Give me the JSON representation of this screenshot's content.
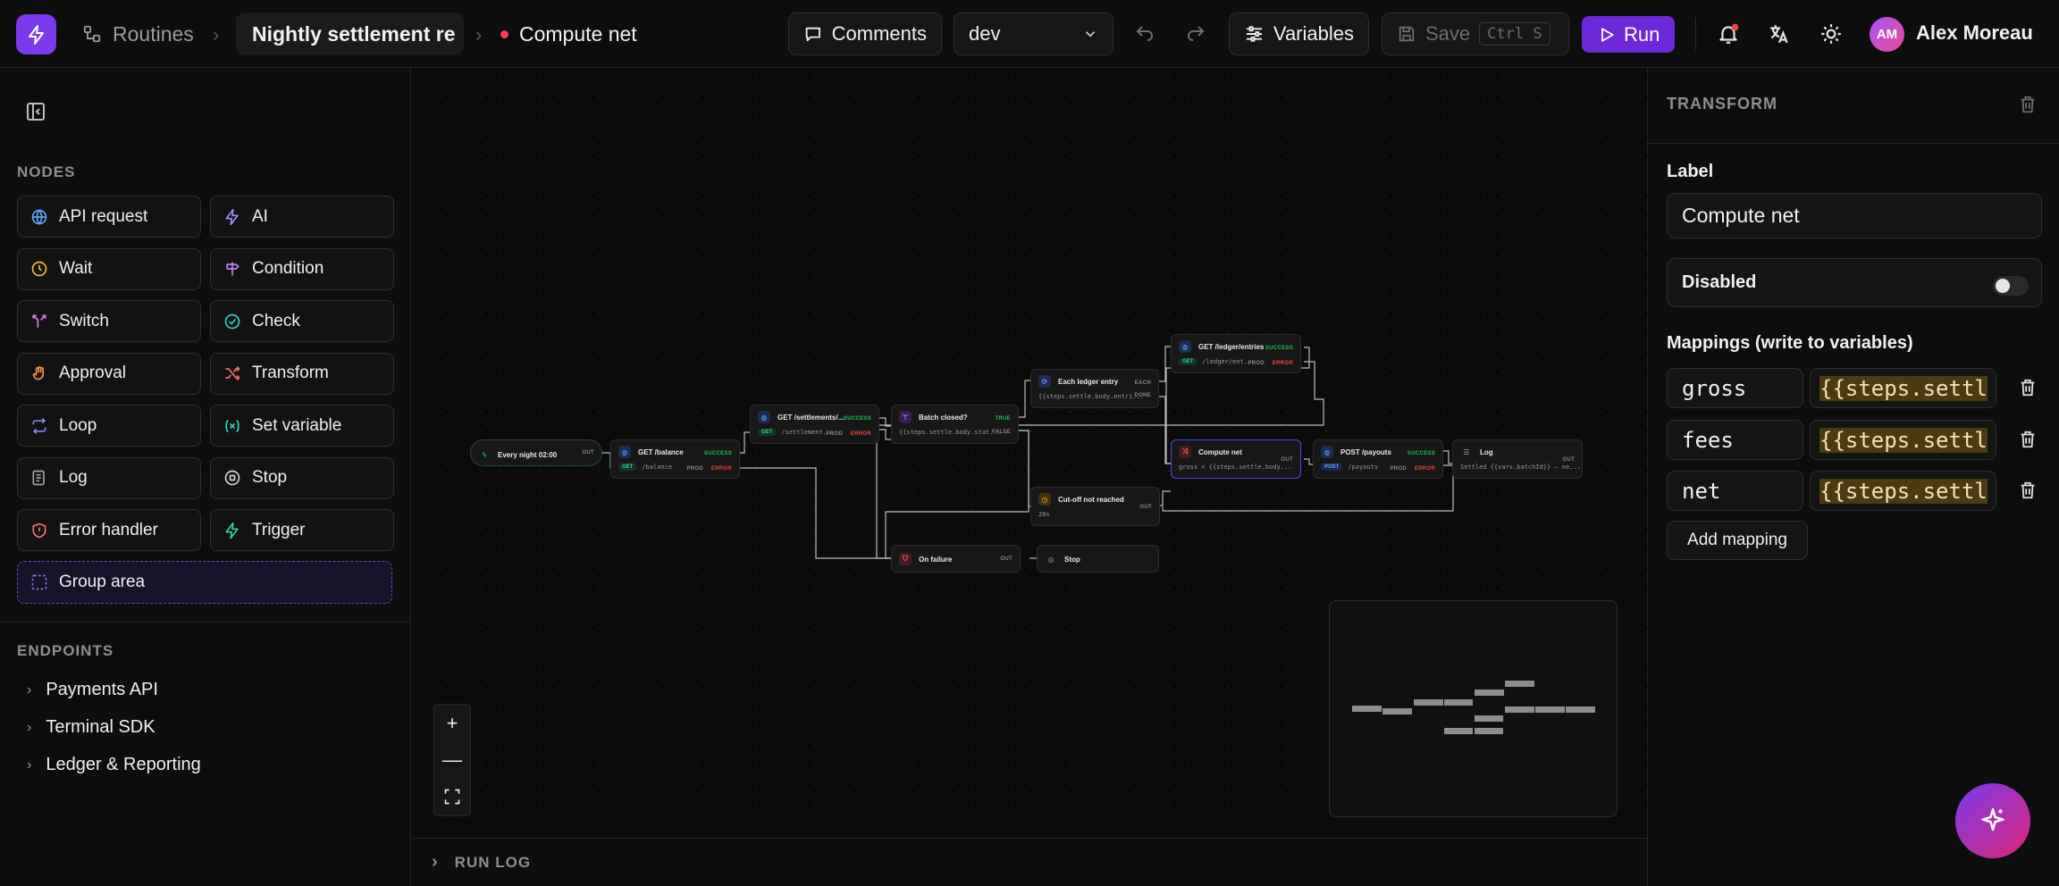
{
  "topbar": {
    "routines_label": "Routines",
    "flow_name": "Nightly settlement re",
    "current_node": "Compute net",
    "comments_label": "Comments",
    "env_value": "dev",
    "variables_label": "Variables",
    "save_label": "Save",
    "save_shortcut": "Ctrl S",
    "run_label": "Run",
    "avatar_initials": "AM",
    "user_name": "Alex Moreau"
  },
  "sidebar": {
    "nodes_heading": "NODES",
    "nodes": [
      {
        "label": "API request",
        "icon": "globe-icon"
      },
      {
        "label": "AI",
        "icon": "sparkle-icon"
      },
      {
        "label": "Wait",
        "icon": "clock-icon"
      },
      {
        "label": "Condition",
        "icon": "signpost-icon"
      },
      {
        "label": "Switch",
        "icon": "split-icon"
      },
      {
        "label": "Check",
        "icon": "check-circle-icon"
      },
      {
        "label": "Approval",
        "icon": "hand-icon"
      },
      {
        "label": "Transform",
        "icon": "shuffle-icon"
      },
      {
        "label": "Loop",
        "icon": "repeat-icon"
      },
      {
        "label": "Set variable",
        "icon": "variable-icon"
      },
      {
        "label": "Log",
        "icon": "log-icon"
      },
      {
        "label": "Stop",
        "icon": "stop-icon"
      },
      {
        "label": "Error handler",
        "icon": "shield-alert-icon"
      },
      {
        "label": "Trigger",
        "icon": "zap-icon"
      }
    ],
    "group_area_label": "Group area",
    "endpoints_heading": "ENDPOINTS",
    "endpoints": [
      "Payments API",
      "Terminal SDK",
      "Ledger & Reporting"
    ]
  },
  "canvas": {
    "nodes": {
      "trigger": {
        "title": "Every night 02:00",
        "out": "OUT"
      },
      "balance": {
        "title": "GET /balance",
        "method": "GET",
        "path": "/balance",
        "env": "PROD",
        "success": "SUCCESS",
        "error": "ERROR"
      },
      "settlements": {
        "title": "GET /settlements/...",
        "method": "GET",
        "path": "/settlement...",
        "env": "PROD",
        "success": "SUCCESS",
        "error": "ERROR"
      },
      "batch": {
        "title": "Batch closed?",
        "expr": "{{steps.settle.body.stat...",
        "true": "TRUE",
        "false": "FALSE"
      },
      "loop": {
        "title": "Each ledger entry",
        "expr": "{{steps.settle.body.entri...",
        "each": "EACH",
        "done": "DONE"
      },
      "ledger": {
        "title": "GET /ledger/entries",
        "method": "GET",
        "path": "/ledger/ent...",
        "env": "PROD",
        "success": "SUCCESS",
        "error": "ERROR"
      },
      "compute": {
        "title": "Compute net",
        "expr": "gross = {{steps.settle.body...",
        "out": "OUT"
      },
      "payouts": {
        "title": "POST /payouts",
        "method": "POST",
        "path": "/payouts",
        "env": "PROD",
        "success": "SUCCESS",
        "error": "ERROR"
      },
      "log": {
        "title": "Log",
        "expr": "Settled {{vars.batchId}} — ne...",
        "out": "OUT"
      },
      "cutoff": {
        "title": "Cut-off not reached",
        "expr": "20s",
        "out": "OUT"
      },
      "failure": {
        "title": "On failure",
        "out": "OUT"
      },
      "stop": {
        "title": "Stop"
      }
    }
  },
  "runlog": {
    "label": "RUN LOG"
  },
  "panel": {
    "heading": "TRANSFORM",
    "label_label": "Label",
    "label_value": "Compute net",
    "disabled_label": "Disabled",
    "disabled_on": false,
    "mappings_label": "Mappings (write to variables)",
    "mappings": [
      {
        "key": "gross",
        "value": "{{steps.settl"
      },
      {
        "key": "fees",
        "value": "{{steps.settl"
      },
      {
        "key": "net",
        "value": "{{steps.settl"
      }
    ],
    "add_mapping_label": "Add mapping"
  },
  "colors": {
    "accent": "#7c3aed",
    "run_button": "#6d28d9",
    "success": "#22c55e",
    "error": "#ef4444",
    "expression_highlight": "#4b3a12"
  }
}
